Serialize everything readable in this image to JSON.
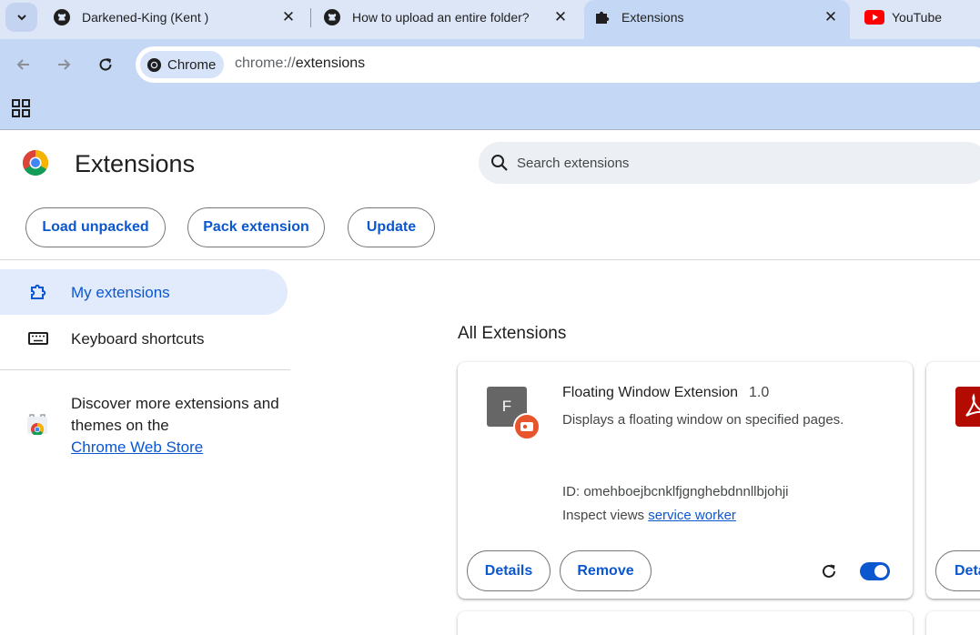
{
  "tabs": [
    {
      "title": "Darkened-King (Kent )",
      "icon": "github-icon"
    },
    {
      "title": "How to upload an entire folder?",
      "icon": "github-icon"
    },
    {
      "title": "Extensions",
      "icon": "puzzle-icon",
      "active": true
    },
    {
      "title": "YouTube",
      "icon": "youtube-icon"
    }
  ],
  "toolbar": {
    "chip_label": "Chrome",
    "url_scheme": "chrome://",
    "url_path": "extensions"
  },
  "page": {
    "title": "Extensions",
    "search_placeholder": "Search extensions",
    "buttons": {
      "load_unpacked": "Load unpacked",
      "pack_extension": "Pack extension",
      "update": "Update"
    }
  },
  "sidebar": {
    "items": [
      {
        "label": "My extensions",
        "icon": "extensions-icon",
        "active": true
      },
      {
        "label": "Keyboard shortcuts",
        "icon": "keyboard-icon"
      }
    ],
    "discover_text": "Discover more extensions and themes on the",
    "store_link": "Chrome Web Store"
  },
  "main": {
    "section_title": "All Extensions",
    "extension": {
      "icon_letter": "F",
      "name": "Floating Window Extension",
      "version": "1.0",
      "description": "Displays a floating window on specified pages.",
      "id_text": "ID: omehboejbcnklfjgnghebdnnllbjohji",
      "inspect_label": "Inspect views",
      "inspect_link": "service worker",
      "details_label": "Details",
      "remove_label": "Remove",
      "enabled": true
    },
    "second_card_details_label": "Details"
  },
  "colors": {
    "accent": "#0b57d0",
    "tabstrip": "#dde6f7",
    "toolbar": "#c4d8f6"
  }
}
